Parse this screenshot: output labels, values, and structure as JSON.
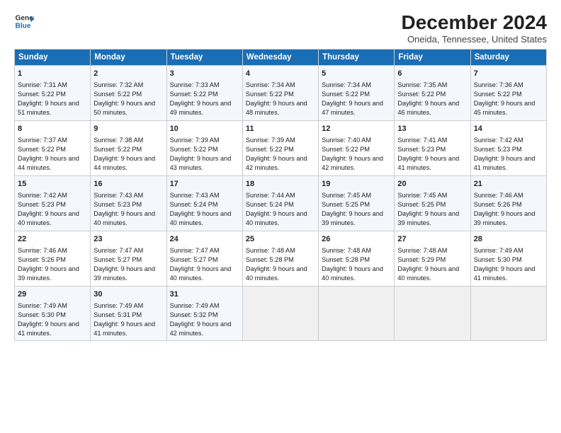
{
  "header": {
    "logo_line1": "General",
    "logo_line2": "Blue",
    "title": "December 2024",
    "subtitle": "Oneida, Tennessee, United States"
  },
  "days_of_week": [
    "Sunday",
    "Monday",
    "Tuesday",
    "Wednesday",
    "Thursday",
    "Friday",
    "Saturday"
  ],
  "weeks": [
    [
      {
        "day": 1,
        "sunrise": "7:31 AM",
        "sunset": "5:22 PM",
        "daylight": "9 hours and 51 minutes."
      },
      {
        "day": 2,
        "sunrise": "7:32 AM",
        "sunset": "5:22 PM",
        "daylight": "9 hours and 50 minutes."
      },
      {
        "day": 3,
        "sunrise": "7:33 AM",
        "sunset": "5:22 PM",
        "daylight": "9 hours and 49 minutes."
      },
      {
        "day": 4,
        "sunrise": "7:34 AM",
        "sunset": "5:22 PM",
        "daylight": "9 hours and 48 minutes."
      },
      {
        "day": 5,
        "sunrise": "7:34 AM",
        "sunset": "5:22 PM",
        "daylight": "9 hours and 47 minutes."
      },
      {
        "day": 6,
        "sunrise": "7:35 AM",
        "sunset": "5:22 PM",
        "daylight": "9 hours and 46 minutes."
      },
      {
        "day": 7,
        "sunrise": "7:36 AM",
        "sunset": "5:22 PM",
        "daylight": "9 hours and 45 minutes."
      }
    ],
    [
      {
        "day": 8,
        "sunrise": "7:37 AM",
        "sunset": "5:22 PM",
        "daylight": "9 hours and 44 minutes."
      },
      {
        "day": 9,
        "sunrise": "7:38 AM",
        "sunset": "5:22 PM",
        "daylight": "9 hours and 44 minutes."
      },
      {
        "day": 10,
        "sunrise": "7:39 AM",
        "sunset": "5:22 PM",
        "daylight": "9 hours and 43 minutes."
      },
      {
        "day": 11,
        "sunrise": "7:39 AM",
        "sunset": "5:22 PM",
        "daylight": "9 hours and 42 minutes."
      },
      {
        "day": 12,
        "sunrise": "7:40 AM",
        "sunset": "5:22 PM",
        "daylight": "9 hours and 42 minutes."
      },
      {
        "day": 13,
        "sunrise": "7:41 AM",
        "sunset": "5:23 PM",
        "daylight": "9 hours and 41 minutes."
      },
      {
        "day": 14,
        "sunrise": "7:42 AM",
        "sunset": "5:23 PM",
        "daylight": "9 hours and 41 minutes."
      }
    ],
    [
      {
        "day": 15,
        "sunrise": "7:42 AM",
        "sunset": "5:23 PM",
        "daylight": "9 hours and 40 minutes."
      },
      {
        "day": 16,
        "sunrise": "7:43 AM",
        "sunset": "5:23 PM",
        "daylight": "9 hours and 40 minutes."
      },
      {
        "day": 17,
        "sunrise": "7:43 AM",
        "sunset": "5:24 PM",
        "daylight": "9 hours and 40 minutes."
      },
      {
        "day": 18,
        "sunrise": "7:44 AM",
        "sunset": "5:24 PM",
        "daylight": "9 hours and 40 minutes."
      },
      {
        "day": 19,
        "sunrise": "7:45 AM",
        "sunset": "5:25 PM",
        "daylight": "9 hours and 39 minutes."
      },
      {
        "day": 20,
        "sunrise": "7:45 AM",
        "sunset": "5:25 PM",
        "daylight": "9 hours and 39 minutes."
      },
      {
        "day": 21,
        "sunrise": "7:46 AM",
        "sunset": "5:26 PM",
        "daylight": "9 hours and 39 minutes."
      }
    ],
    [
      {
        "day": 22,
        "sunrise": "7:46 AM",
        "sunset": "5:26 PM",
        "daylight": "9 hours and 39 minutes."
      },
      {
        "day": 23,
        "sunrise": "7:47 AM",
        "sunset": "5:27 PM",
        "daylight": "9 hours and 39 minutes."
      },
      {
        "day": 24,
        "sunrise": "7:47 AM",
        "sunset": "5:27 PM",
        "daylight": "9 hours and 40 minutes."
      },
      {
        "day": 25,
        "sunrise": "7:48 AM",
        "sunset": "5:28 PM",
        "daylight": "9 hours and 40 minutes."
      },
      {
        "day": 26,
        "sunrise": "7:48 AM",
        "sunset": "5:28 PM",
        "daylight": "9 hours and 40 minutes."
      },
      {
        "day": 27,
        "sunrise": "7:48 AM",
        "sunset": "5:29 PM",
        "daylight": "9 hours and 40 minutes."
      },
      {
        "day": 28,
        "sunrise": "7:49 AM",
        "sunset": "5:30 PM",
        "daylight": "9 hours and 41 minutes."
      }
    ],
    [
      {
        "day": 29,
        "sunrise": "7:49 AM",
        "sunset": "5:30 PM",
        "daylight": "9 hours and 41 minutes."
      },
      {
        "day": 30,
        "sunrise": "7:49 AM",
        "sunset": "5:31 PM",
        "daylight": "9 hours and 41 minutes."
      },
      {
        "day": 31,
        "sunrise": "7:49 AM",
        "sunset": "5:32 PM",
        "daylight": "9 hours and 42 minutes."
      },
      null,
      null,
      null,
      null
    ]
  ]
}
